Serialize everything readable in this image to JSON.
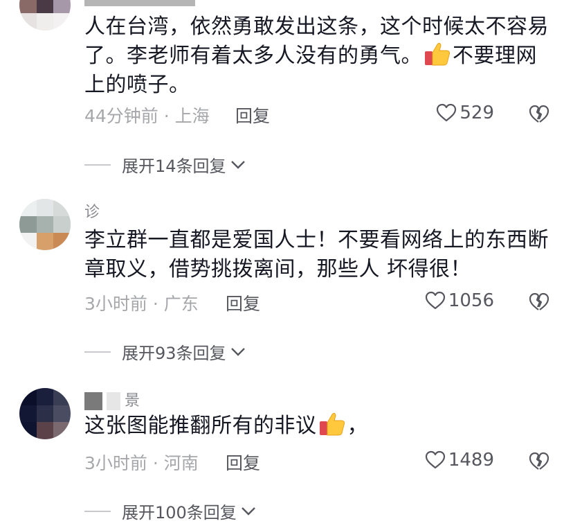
{
  "comments": [
    {
      "name": "",
      "text_parts": [
        "人在台湾，依然勇敢发出这条，这个时候太不容易了。李老师有着太多人没有的勇气。",
        "不要理网上的喷子。"
      ],
      "time_location": "44分钟前 · 上海",
      "reply_label": "回复",
      "likes": "529",
      "expand_label": "展开14条回复"
    },
    {
      "name": "诊",
      "text_parts": [
        "李立群一直都是爱国人士！不要看网络上的东西断章取义，借势挑拨离间，那些人 坏得很！"
      ],
      "time_location": "3小时前 · 广东",
      "reply_label": "回复",
      "likes": "1056",
      "expand_label": "展开93条回复"
    },
    {
      "name": "景",
      "text_parts": [
        "这张图能推翻所有的非议",
        "，"
      ],
      "time_location": "3小时前 · 河南",
      "reply_label": "回复",
      "likes": "1489",
      "expand_label": "展开100条回复"
    }
  ],
  "icons": {
    "like": "heart-outline-icon",
    "dislike": "broken-heart-icon",
    "emoji": "thumbs-up-emoji",
    "expand": "chevron-down-icon"
  },
  "colors": {
    "text": "#161823",
    "meta": "#a6a7ab",
    "action": "#56575e"
  }
}
